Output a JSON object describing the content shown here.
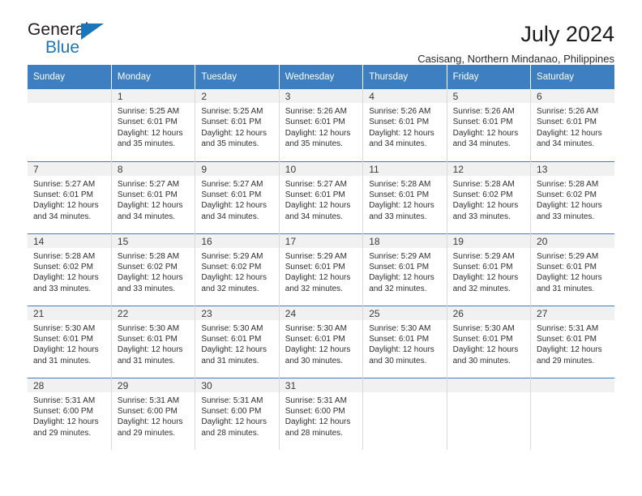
{
  "brand": {
    "name_top": "General",
    "name_bottom": "Blue",
    "accent_color": "#1b75bb"
  },
  "header": {
    "title": "July 2024",
    "subtitle": "Casisang, Northern Mindanao, Philippines"
  },
  "calendar": {
    "header_bg": "#3d7fc1",
    "daynum_bg": "#f1f1f1",
    "weekdays": [
      "Sunday",
      "Monday",
      "Tuesday",
      "Wednesday",
      "Thursday",
      "Friday",
      "Saturday"
    ],
    "weeks": [
      [
        {
          "day": ""
        },
        {
          "day": "1",
          "sunrise": "Sunrise: 5:25 AM",
          "sunset": "Sunset: 6:01 PM",
          "daylight_line1": "Daylight: 12 hours",
          "daylight_line2": "and 35 minutes."
        },
        {
          "day": "2",
          "sunrise": "Sunrise: 5:25 AM",
          "sunset": "Sunset: 6:01 PM",
          "daylight_line1": "Daylight: 12 hours",
          "daylight_line2": "and 35 minutes."
        },
        {
          "day": "3",
          "sunrise": "Sunrise: 5:26 AM",
          "sunset": "Sunset: 6:01 PM",
          "daylight_line1": "Daylight: 12 hours",
          "daylight_line2": "and 35 minutes."
        },
        {
          "day": "4",
          "sunrise": "Sunrise: 5:26 AM",
          "sunset": "Sunset: 6:01 PM",
          "daylight_line1": "Daylight: 12 hours",
          "daylight_line2": "and 34 minutes."
        },
        {
          "day": "5",
          "sunrise": "Sunrise: 5:26 AM",
          "sunset": "Sunset: 6:01 PM",
          "daylight_line1": "Daylight: 12 hours",
          "daylight_line2": "and 34 minutes."
        },
        {
          "day": "6",
          "sunrise": "Sunrise: 5:26 AM",
          "sunset": "Sunset: 6:01 PM",
          "daylight_line1": "Daylight: 12 hours",
          "daylight_line2": "and 34 minutes."
        }
      ],
      [
        {
          "day": "7",
          "sunrise": "Sunrise: 5:27 AM",
          "sunset": "Sunset: 6:01 PM",
          "daylight_line1": "Daylight: 12 hours",
          "daylight_line2": "and 34 minutes."
        },
        {
          "day": "8",
          "sunrise": "Sunrise: 5:27 AM",
          "sunset": "Sunset: 6:01 PM",
          "daylight_line1": "Daylight: 12 hours",
          "daylight_line2": "and 34 minutes."
        },
        {
          "day": "9",
          "sunrise": "Sunrise: 5:27 AM",
          "sunset": "Sunset: 6:01 PM",
          "daylight_line1": "Daylight: 12 hours",
          "daylight_line2": "and 34 minutes."
        },
        {
          "day": "10",
          "sunrise": "Sunrise: 5:27 AM",
          "sunset": "Sunset: 6:01 PM",
          "daylight_line1": "Daylight: 12 hours",
          "daylight_line2": "and 34 minutes."
        },
        {
          "day": "11",
          "sunrise": "Sunrise: 5:28 AM",
          "sunset": "Sunset: 6:01 PM",
          "daylight_line1": "Daylight: 12 hours",
          "daylight_line2": "and 33 minutes."
        },
        {
          "day": "12",
          "sunrise": "Sunrise: 5:28 AM",
          "sunset": "Sunset: 6:02 PM",
          "daylight_line1": "Daylight: 12 hours",
          "daylight_line2": "and 33 minutes."
        },
        {
          "day": "13",
          "sunrise": "Sunrise: 5:28 AM",
          "sunset": "Sunset: 6:02 PM",
          "daylight_line1": "Daylight: 12 hours",
          "daylight_line2": "and 33 minutes."
        }
      ],
      [
        {
          "day": "14",
          "sunrise": "Sunrise: 5:28 AM",
          "sunset": "Sunset: 6:02 PM",
          "daylight_line1": "Daylight: 12 hours",
          "daylight_line2": "and 33 minutes."
        },
        {
          "day": "15",
          "sunrise": "Sunrise: 5:28 AM",
          "sunset": "Sunset: 6:02 PM",
          "daylight_line1": "Daylight: 12 hours",
          "daylight_line2": "and 33 minutes."
        },
        {
          "day": "16",
          "sunrise": "Sunrise: 5:29 AM",
          "sunset": "Sunset: 6:02 PM",
          "daylight_line1": "Daylight: 12 hours",
          "daylight_line2": "and 32 minutes."
        },
        {
          "day": "17",
          "sunrise": "Sunrise: 5:29 AM",
          "sunset": "Sunset: 6:01 PM",
          "daylight_line1": "Daylight: 12 hours",
          "daylight_line2": "and 32 minutes."
        },
        {
          "day": "18",
          "sunrise": "Sunrise: 5:29 AM",
          "sunset": "Sunset: 6:01 PM",
          "daylight_line1": "Daylight: 12 hours",
          "daylight_line2": "and 32 minutes."
        },
        {
          "day": "19",
          "sunrise": "Sunrise: 5:29 AM",
          "sunset": "Sunset: 6:01 PM",
          "daylight_line1": "Daylight: 12 hours",
          "daylight_line2": "and 32 minutes."
        },
        {
          "day": "20",
          "sunrise": "Sunrise: 5:29 AM",
          "sunset": "Sunset: 6:01 PM",
          "daylight_line1": "Daylight: 12 hours",
          "daylight_line2": "and 31 minutes."
        }
      ],
      [
        {
          "day": "21",
          "sunrise": "Sunrise: 5:30 AM",
          "sunset": "Sunset: 6:01 PM",
          "daylight_line1": "Daylight: 12 hours",
          "daylight_line2": "and 31 minutes."
        },
        {
          "day": "22",
          "sunrise": "Sunrise: 5:30 AM",
          "sunset": "Sunset: 6:01 PM",
          "daylight_line1": "Daylight: 12 hours",
          "daylight_line2": "and 31 minutes."
        },
        {
          "day": "23",
          "sunrise": "Sunrise: 5:30 AM",
          "sunset": "Sunset: 6:01 PM",
          "daylight_line1": "Daylight: 12 hours",
          "daylight_line2": "and 31 minutes."
        },
        {
          "day": "24",
          "sunrise": "Sunrise: 5:30 AM",
          "sunset": "Sunset: 6:01 PM",
          "daylight_line1": "Daylight: 12 hours",
          "daylight_line2": "and 30 minutes."
        },
        {
          "day": "25",
          "sunrise": "Sunrise: 5:30 AM",
          "sunset": "Sunset: 6:01 PM",
          "daylight_line1": "Daylight: 12 hours",
          "daylight_line2": "and 30 minutes."
        },
        {
          "day": "26",
          "sunrise": "Sunrise: 5:30 AM",
          "sunset": "Sunset: 6:01 PM",
          "daylight_line1": "Daylight: 12 hours",
          "daylight_line2": "and 30 minutes."
        },
        {
          "day": "27",
          "sunrise": "Sunrise: 5:31 AM",
          "sunset": "Sunset: 6:01 PM",
          "daylight_line1": "Daylight: 12 hours",
          "daylight_line2": "and 29 minutes."
        }
      ],
      [
        {
          "day": "28",
          "sunrise": "Sunrise: 5:31 AM",
          "sunset": "Sunset: 6:00 PM",
          "daylight_line1": "Daylight: 12 hours",
          "daylight_line2": "and 29 minutes."
        },
        {
          "day": "29",
          "sunrise": "Sunrise: 5:31 AM",
          "sunset": "Sunset: 6:00 PM",
          "daylight_line1": "Daylight: 12 hours",
          "daylight_line2": "and 29 minutes."
        },
        {
          "day": "30",
          "sunrise": "Sunrise: 5:31 AM",
          "sunset": "Sunset: 6:00 PM",
          "daylight_line1": "Daylight: 12 hours",
          "daylight_line2": "and 28 minutes."
        },
        {
          "day": "31",
          "sunrise": "Sunrise: 5:31 AM",
          "sunset": "Sunset: 6:00 PM",
          "daylight_line1": "Daylight: 12 hours",
          "daylight_line2": "and 28 minutes."
        },
        {
          "day": ""
        },
        {
          "day": ""
        },
        {
          "day": ""
        }
      ]
    ]
  }
}
